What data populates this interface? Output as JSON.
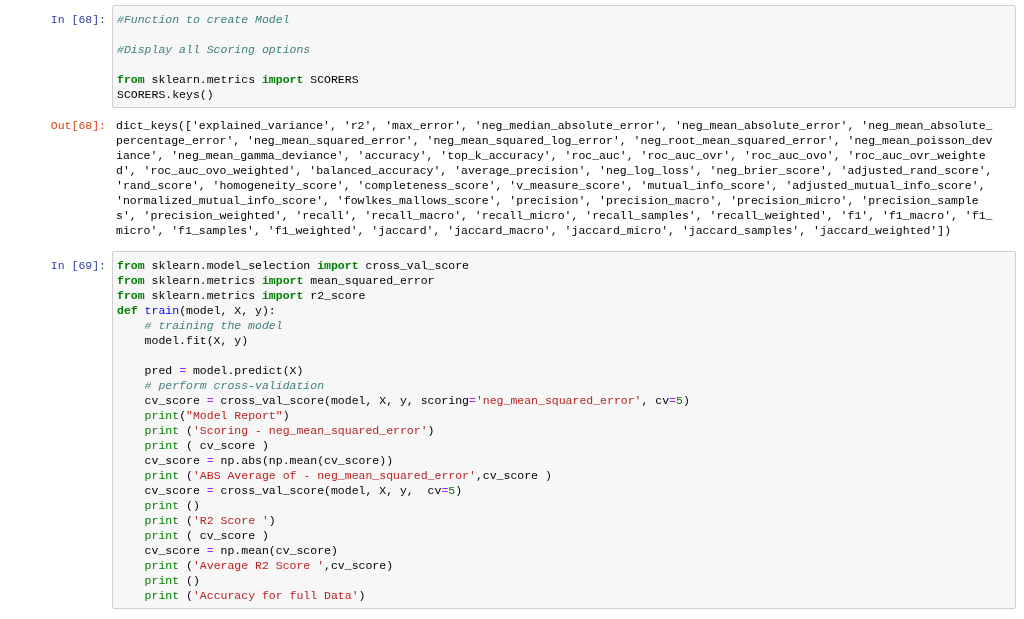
{
  "cells": [
    {
      "kind": "input",
      "prompt": "In [68]:",
      "lines": [
        {
          "tokens": [
            {
              "kind": "comment",
              "text": "#Function to create Model"
            }
          ]
        },
        {
          "blank_before": true,
          "tokens": [
            {
              "kind": "comment",
              "text": "#Display all Scoring options"
            }
          ]
        },
        {
          "blank_before": true,
          "tokens": [
            {
              "kind": "keyword",
              "text": "from"
            },
            {
              "kind": "plain",
              "text": " sklearn.metrics "
            },
            {
              "kind": "keyword",
              "text": "import"
            },
            {
              "kind": "plain",
              "text": " SCORERS"
            }
          ]
        },
        {
          "tokens": [
            {
              "kind": "plain",
              "text": "SCORERS.keys()"
            }
          ]
        }
      ]
    },
    {
      "kind": "output",
      "prompt": "Out[68]:",
      "lines": [
        "dict_keys(['explained_variance', 'r2', 'max_error', 'neg_median_absolute_error', 'neg_mean_absolute_error', 'neg_mean_absolute_",
        "percentage_error', 'neg_mean_squared_error', 'neg_mean_squared_log_error', 'neg_root_mean_squared_error', 'neg_mean_poisson_dev",
        "iance', 'neg_mean_gamma_deviance', 'accuracy', 'top_k_accuracy', 'roc_auc', 'roc_auc_ovr', 'roc_auc_ovo', 'roc_auc_ovr_weighte",
        "d', 'roc_auc_ovo_weighted', 'balanced_accuracy', 'average_precision', 'neg_log_loss', 'neg_brier_score', 'adjusted_rand_score',",
        "'rand_score', 'homogeneity_score', 'completeness_score', 'v_measure_score', 'mutual_info_score', 'adjusted_mutual_info_score',",
        "'normalized_mutual_info_score', 'fowlkes_mallows_score', 'precision', 'precision_macro', 'precision_micro', 'precision_sample",
        "s', 'precision_weighted', 'recall', 'recall_macro', 'recall_micro', 'recall_samples', 'recall_weighted', 'f1', 'f1_macro', 'f1_",
        "micro', 'f1_samples', 'f1_weighted', 'jaccard', 'jaccard_macro', 'jaccard_micro', 'jaccard_samples', 'jaccard_weighted'])"
      ]
    },
    {
      "kind": "input",
      "prompt": "In [69]:",
      "lines": [
        {
          "tokens": [
            {
              "kind": "keyword",
              "text": "from"
            },
            {
              "kind": "plain",
              "text": " sklearn.model_selection "
            },
            {
              "kind": "keyword",
              "text": "import"
            },
            {
              "kind": "plain",
              "text": " cross_val_score"
            }
          ]
        },
        {
          "tokens": [
            {
              "kind": "keyword",
              "text": "from"
            },
            {
              "kind": "plain",
              "text": " sklearn.metrics "
            },
            {
              "kind": "keyword",
              "text": "import"
            },
            {
              "kind": "plain",
              "text": " mean_squared_error"
            }
          ]
        },
        {
          "tokens": [
            {
              "kind": "keyword",
              "text": "from"
            },
            {
              "kind": "plain",
              "text": " sklearn.metrics "
            },
            {
              "kind": "keyword",
              "text": "import"
            },
            {
              "kind": "plain",
              "text": " r2_score"
            }
          ]
        },
        {
          "tokens": [
            {
              "kind": "keyword",
              "text": "def"
            },
            {
              "kind": "function",
              "text": " train"
            },
            {
              "kind": "plain",
              "text": "(model, X, y):"
            }
          ]
        },
        {
          "tokens": [
            {
              "kind": "comment",
              "text": "    # training the model"
            }
          ]
        },
        {
          "tokens": [
            {
              "kind": "plain",
              "text": "    model.fit(X, y)"
            }
          ]
        },
        {
          "blank_before": true,
          "tokens": [
            {
              "kind": "plain",
              "text": "    pred "
            },
            {
              "kind": "operator",
              "text": "="
            },
            {
              "kind": "plain",
              "text": " model.predict(X)"
            }
          ]
        },
        {
          "tokens": [
            {
              "kind": "comment",
              "text": "    # perform cross-validation"
            }
          ]
        },
        {
          "tokens": [
            {
              "kind": "plain",
              "text": "    cv_score "
            },
            {
              "kind": "operator",
              "text": "="
            },
            {
              "kind": "plain",
              "text": " cross_val_score(model, X, y, scoring"
            },
            {
              "kind": "operator",
              "text": "="
            },
            {
              "kind": "string",
              "text": "'neg_mean_squared_error'"
            },
            {
              "kind": "plain",
              "text": ", cv"
            },
            {
              "kind": "operator",
              "text": "="
            },
            {
              "kind": "number",
              "text": "5"
            },
            {
              "kind": "plain",
              "text": ")"
            }
          ]
        },
        {
          "tokens": [
            {
              "kind": "builtin",
              "text": "    print"
            },
            {
              "kind": "plain",
              "text": "("
            },
            {
              "kind": "string",
              "text": "\"Model Report\""
            },
            {
              "kind": "plain",
              "text": ")"
            }
          ]
        },
        {
          "tokens": [
            {
              "kind": "builtin",
              "text": "    print"
            },
            {
              "kind": "plain",
              "text": " ("
            },
            {
              "kind": "string",
              "text": "'Scoring - neg_mean_squared_error'"
            },
            {
              "kind": "plain",
              "text": ")"
            }
          ]
        },
        {
          "tokens": [
            {
              "kind": "builtin",
              "text": "    print"
            },
            {
              "kind": "plain",
              "text": " ( cv_score )"
            }
          ]
        },
        {
          "tokens": [
            {
              "kind": "plain",
              "text": "    cv_score "
            },
            {
              "kind": "operator",
              "text": "="
            },
            {
              "kind": "plain",
              "text": " np.abs(np.mean(cv_score))"
            }
          ]
        },
        {
          "tokens": [
            {
              "kind": "builtin",
              "text": "    print"
            },
            {
              "kind": "plain",
              "text": " ("
            },
            {
              "kind": "string",
              "text": "'ABS Average of - neg_mean_squared_error'"
            },
            {
              "kind": "plain",
              "text": ",cv_score )"
            }
          ]
        },
        {
          "tokens": [
            {
              "kind": "plain",
              "text": "    cv_score "
            },
            {
              "kind": "operator",
              "text": "="
            },
            {
              "kind": "plain",
              "text": " cross_val_score(model, X, y,  cv"
            },
            {
              "kind": "operator",
              "text": "="
            },
            {
              "kind": "number",
              "text": "5"
            },
            {
              "kind": "plain",
              "text": ")"
            }
          ]
        },
        {
          "tokens": [
            {
              "kind": "builtin",
              "text": "    print"
            },
            {
              "kind": "plain",
              "text": " ()"
            }
          ]
        },
        {
          "tokens": [
            {
              "kind": "builtin",
              "text": "    print"
            },
            {
              "kind": "plain",
              "text": " ("
            },
            {
              "kind": "string",
              "text": "'R2 Score '"
            },
            {
              "kind": "plain",
              "text": ")"
            }
          ]
        },
        {
          "tokens": [
            {
              "kind": "builtin",
              "text": "    print"
            },
            {
              "kind": "plain",
              "text": " ( cv_score )"
            }
          ]
        },
        {
          "tokens": [
            {
              "kind": "plain",
              "text": "    cv_score "
            },
            {
              "kind": "operator",
              "text": "="
            },
            {
              "kind": "plain",
              "text": " np.mean(cv_score)"
            }
          ]
        },
        {
          "tokens": [
            {
              "kind": "builtin",
              "text": "    print"
            },
            {
              "kind": "plain",
              "text": " ("
            },
            {
              "kind": "string",
              "text": "'Average R2 Score '"
            },
            {
              "kind": "plain",
              "text": ",cv_score)"
            }
          ]
        },
        {
          "tokens": [
            {
              "kind": "builtin",
              "text": "    print"
            },
            {
              "kind": "plain",
              "text": " ()"
            }
          ]
        },
        {
          "tokens": [
            {
              "kind": "builtin",
              "text": "    print"
            },
            {
              "kind": "plain",
              "text": " ("
            },
            {
              "kind": "string",
              "text": "'Accuracy for full Data'"
            },
            {
              "kind": "plain",
              "text": ")"
            }
          ]
        }
      ]
    }
  ]
}
